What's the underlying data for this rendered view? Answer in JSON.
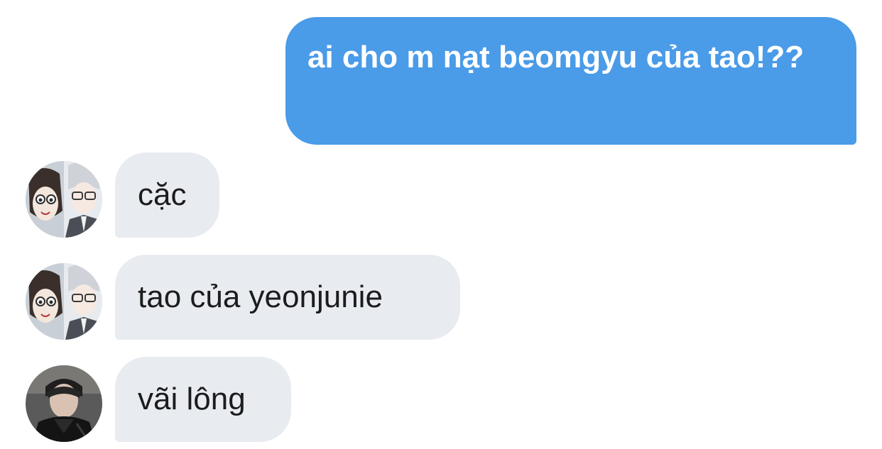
{
  "messages": [
    {
      "sender": "me",
      "text": "ai cho m nạt beomgyu của tao!??"
    },
    {
      "sender": "other",
      "avatar": "anime-collage-avatar",
      "text": "cặc"
    },
    {
      "sender": "other",
      "avatar": "anime-collage-avatar",
      "text": "tao của yeonjunie"
    },
    {
      "sender": "other",
      "avatar": "portrait-avatar",
      "text": "vãi lông"
    }
  ],
  "colors": {
    "outgoing_bubble": "#4a9be8",
    "incoming_bubble": "#e8ebf0",
    "outgoing_text": "#ffffff",
    "incoming_text": "#1c1c1e"
  }
}
